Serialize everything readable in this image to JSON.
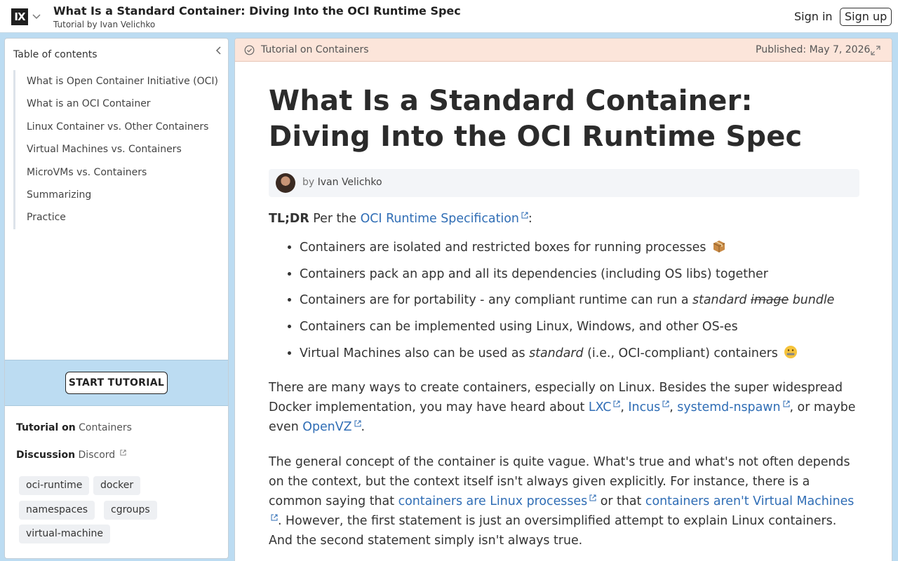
{
  "header": {
    "logo": "IX",
    "title": "What Is a Standard Container: Diving Into the OCI Runtime Spec",
    "subtitle": "Tutorial by Ivan Velichko",
    "sign_in": "Sign in",
    "sign_up": "Sign up"
  },
  "sidebar": {
    "toc_title": "Table of contents",
    "toc": [
      "What is Open Container Initiative (OCI)",
      "What is an OCI Container",
      "Linux Container vs. Other Containers",
      "Virtual Machines vs. Containers",
      "MicroVMs vs. Containers",
      "Summarizing",
      "Practice"
    ],
    "start_button": "START TUTORIAL",
    "tutorial_on_label": "Tutorial on",
    "tutorial_on_value": "Containers",
    "discussion_label": "Discussion",
    "discussion_value": "Discord",
    "tags": [
      "oci-runtime",
      "docker",
      "namespaces",
      "cgroups",
      "virtual-machine"
    ]
  },
  "banner": {
    "label": "Tutorial on Containers",
    "published": "Published: May 7, 2026"
  },
  "article": {
    "title": "What Is a Standard Container: Diving Into the OCI Runtime Spec",
    "by": "by",
    "author": "Ivan Velichko",
    "tldr_label": "TL;DR",
    "tldr_text": "Per the",
    "tldr_link": "OCI Runtime Specification",
    "tldr_colon": ":",
    "bullets": {
      "b1": "Containers are isolated and restricted boxes for running processes",
      "b2": "Containers pack an app and all its dependencies (including OS libs) together",
      "b3_pre": "Containers are for portability - any compliant runtime can run a",
      "b3_std": "standard",
      "b3_strike": "image",
      "b3_bundle": "bundle",
      "b4": "Containers can be implemented using Linux, Windows, and other OS-es",
      "b5_pre": "Virtual Machines also can be used as",
      "b5_std": "standard",
      "b5_post": "(i.e., OCI-compliant) containers"
    },
    "p1": {
      "t1": "There are many ways to create containers, especially on Linux. Besides the super widespread Docker implementation, you may have heard about",
      "lxc": "LXC",
      "incus": "Incus",
      "nspawn": "systemd-nspawn",
      "t2": ", or maybe even",
      "openvz": "OpenVZ",
      "t3": "."
    },
    "p2": {
      "t1": "The general concept of the container is quite vague. What's true and what's not often depends on the context, but the context itself isn't always given explicitly. For instance, there is a common saying that",
      "link1": "containers are Linux processes",
      "t2": "or that",
      "link2": "containers aren't Virtual Machines",
      "t3": ". However, the first statement is just an oversimplified attempt to explain Linux containers. And the second statement simply isn't always true."
    }
  },
  "colors": {
    "accent_link": "#2f6db5",
    "page_bg": "#bcdcf2",
    "banner_bg": "#fce5da"
  }
}
